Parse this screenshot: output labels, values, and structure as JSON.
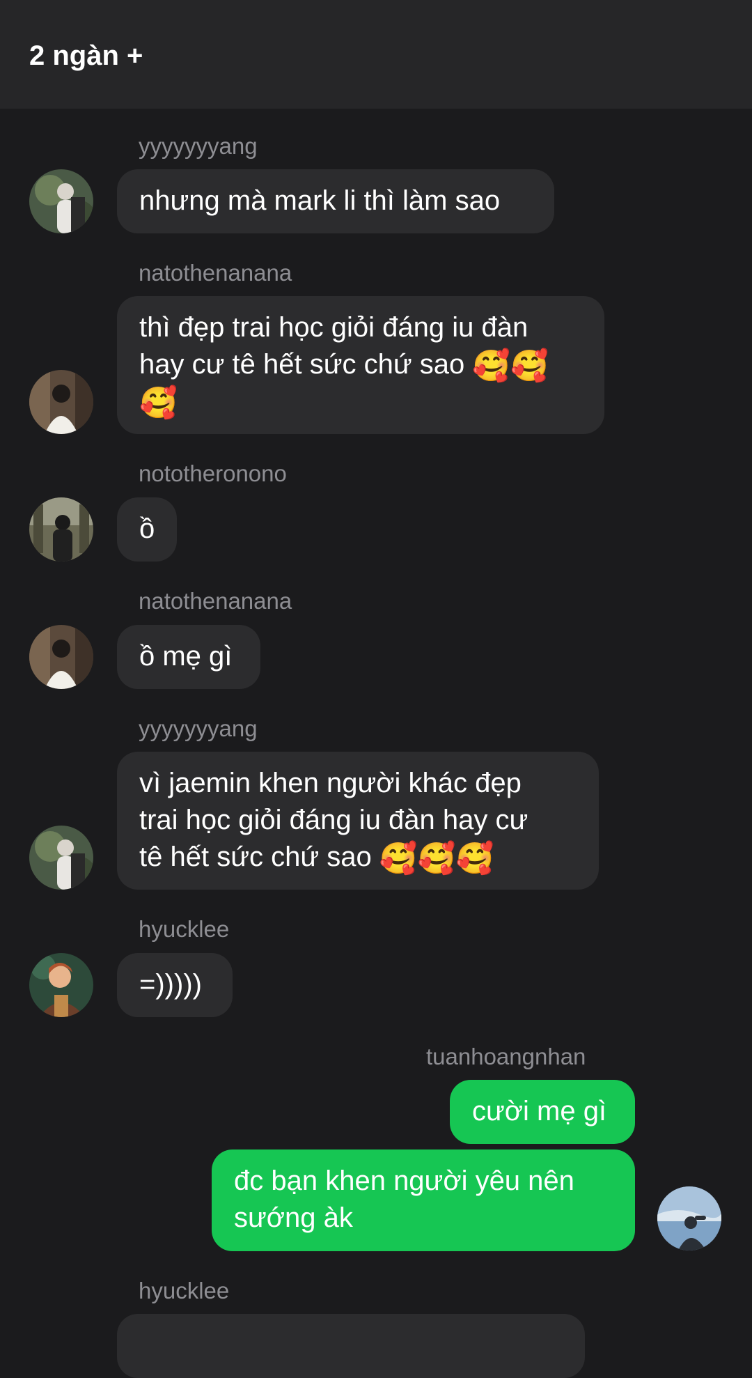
{
  "header": {
    "title": "2 ngàn +"
  },
  "messages": [
    {
      "sender": "yyyyyyyang",
      "text": "nhưng mà mark li thì làm sao",
      "mine": false
    },
    {
      "sender": "natothenanana",
      "text_line1": "thì đẹp trai học giỏi đáng iu đàn",
      "text_line2": "hay cư tê hết sức chứ sao",
      "emoji": "🥰",
      "mine": false
    },
    {
      "sender": "nototheronono",
      "text": "ồ",
      "mine": false
    },
    {
      "sender": "natothenanana",
      "text": "ồ mẹ gì",
      "mine": false
    },
    {
      "sender": "yyyyyyyang",
      "text_line1": "vì jaemin khen người khác đẹp",
      "text_line2": "trai học giỏi đáng iu đàn hay cư",
      "text_line3": "tê hết sức chứ sao",
      "emoji": "🥰",
      "mine": false
    },
    {
      "sender": "hyucklee",
      "text": "=)))))",
      "mine": false
    },
    {
      "sender": "tuanhoangnhan",
      "text": "cười mẹ gì",
      "mine": true
    },
    {
      "text_line1": "đc bạn khen người yêu nên",
      "text_line2": "sướng àk",
      "mine": true
    },
    {
      "sender": "hyucklee",
      "mine": false
    }
  ],
  "colors": {
    "background": "#1b1b1d",
    "header": "#262628",
    "bubble_other": "#2c2c2e",
    "bubble_mine": "#16c653",
    "sender_text": "#8e8e93"
  }
}
